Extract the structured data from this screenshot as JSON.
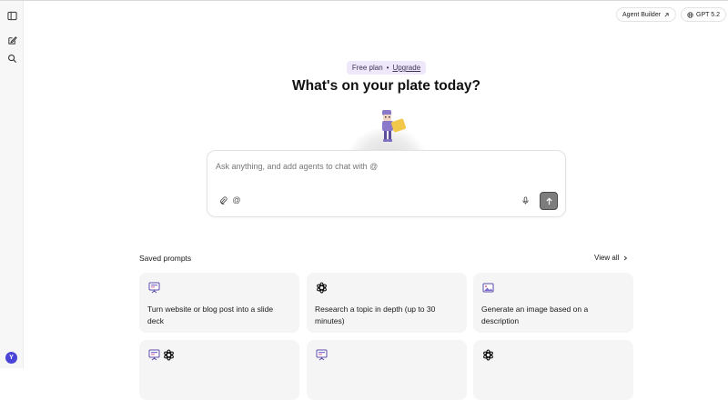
{
  "sidebar": {
    "items": [
      {
        "name": "sidebar-toggle",
        "icon": "sidebar-panel-icon"
      },
      {
        "name": "new-chat",
        "icon": "edit-icon"
      },
      {
        "name": "search",
        "icon": "search-icon"
      }
    ],
    "avatar_initial": "Y",
    "avatar_color": "#4a45d6"
  },
  "header": {
    "agent_builder_label": "Agent Builder",
    "agent_builder_icon": "external-arrow-icon",
    "model_label": "GPT 5.2",
    "model_icon": "globe-icon"
  },
  "plan": {
    "text": "Free plan",
    "separator": "•",
    "upgrade_label": "Upgrade"
  },
  "headline": "What's on your plate today?",
  "chat": {
    "placeholder": "Ask anything, and add agents to chat with @",
    "value": "",
    "tools": [
      "paperclip-icon",
      "at-icon",
      "microphone-icon"
    ],
    "send_icon": "arrow-up-icon"
  },
  "saved_prompts": {
    "title": "Saved prompts",
    "view_all_label": "View all",
    "cards": [
      {
        "icons": [
          "presentation-icon"
        ],
        "label": "Turn website or blog post into a slide deck"
      },
      {
        "icons": [
          "openai-icon"
        ],
        "label": "Research a topic in depth (up to 30 minutes)"
      },
      {
        "icons": [
          "image-icon"
        ],
        "label": "Generate an image based on a description"
      },
      {
        "icons": [
          "presentation-icon",
          "openai-icon"
        ],
        "label": ""
      },
      {
        "icons": [
          "presentation-icon"
        ],
        "label": ""
      },
      {
        "icons": [
          "openai-icon"
        ],
        "label": ""
      }
    ]
  },
  "colors": {
    "accent": "#4a45d6",
    "badge_bg": "#efe8fb",
    "card_bg": "#f5f5f5",
    "send_bg": "#7d7d7d"
  }
}
